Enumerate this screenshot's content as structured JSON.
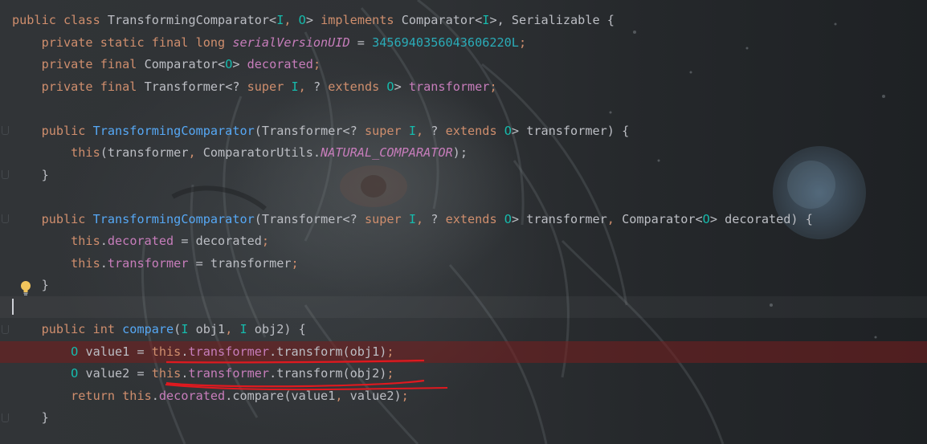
{
  "colors": {
    "keyword": "#cf8e6d",
    "type_param": "#16baac",
    "field": "#c77dbb",
    "number": "#2aacb8",
    "method": "#56a8f5",
    "text": "#bcbec4",
    "breakpoint_line": "#5a2326",
    "annotation_underline": "#e0191f"
  },
  "icons": {
    "intention_bulb": "lightbulb-icon"
  },
  "code": {
    "lines": [
      [
        {
          "t": "public class ",
          "c": "kw"
        },
        {
          "t": "TransformingComparator",
          "c": "cls"
        },
        {
          "t": "<",
          "c": "pun"
        },
        {
          "t": "I",
          "c": "tp"
        },
        {
          "t": ", ",
          "c": "sep"
        },
        {
          "t": "O",
          "c": "tp"
        },
        {
          "t": "> ",
          "c": "pun"
        },
        {
          "t": "implements ",
          "c": "kw"
        },
        {
          "t": "Comparator",
          "c": "cls"
        },
        {
          "t": "<",
          "c": "pun"
        },
        {
          "t": "I",
          "c": "tp"
        },
        {
          "t": ">, ",
          "c": "pun"
        },
        {
          "t": "Serializable ",
          "c": "cls"
        },
        {
          "t": "{",
          "c": "pun"
        }
      ],
      [
        {
          "t": "    private static final long ",
          "c": "kw"
        },
        {
          "t": "serialVersionUID",
          "c": "fld-it"
        },
        {
          "t": " = ",
          "c": "pun"
        },
        {
          "t": "3456940356043606220L",
          "c": "num"
        },
        {
          "t": ";",
          "c": "sep"
        }
      ],
      [
        {
          "t": "    private final ",
          "c": "kw"
        },
        {
          "t": "Comparator",
          "c": "cls"
        },
        {
          "t": "<",
          "c": "pun"
        },
        {
          "t": "O",
          "c": "tp"
        },
        {
          "t": "> ",
          "c": "pun"
        },
        {
          "t": "decorated",
          "c": "fld"
        },
        {
          "t": ";",
          "c": "sep"
        }
      ],
      [
        {
          "t": "    private final ",
          "c": "kw"
        },
        {
          "t": "Transformer",
          "c": "cls"
        },
        {
          "t": "<? ",
          "c": "pun"
        },
        {
          "t": "super ",
          "c": "kw"
        },
        {
          "t": "I",
          "c": "tp"
        },
        {
          "t": ", ",
          "c": "sep"
        },
        {
          "t": "? ",
          "c": "pun"
        },
        {
          "t": "extends ",
          "c": "kw"
        },
        {
          "t": "O",
          "c": "tp"
        },
        {
          "t": "> ",
          "c": "pun"
        },
        {
          "t": "transformer",
          "c": "fld"
        },
        {
          "t": ";",
          "c": "sep"
        }
      ],
      [],
      [
        {
          "t": "    public ",
          "c": "kw"
        },
        {
          "t": "TransformingComparator",
          "c": "mth"
        },
        {
          "t": "(",
          "c": "pun"
        },
        {
          "t": "Transformer",
          "c": "cls"
        },
        {
          "t": "<? ",
          "c": "pun"
        },
        {
          "t": "super ",
          "c": "kw"
        },
        {
          "t": "I",
          "c": "tp"
        },
        {
          "t": ", ",
          "c": "sep"
        },
        {
          "t": "? ",
          "c": "pun"
        },
        {
          "t": "extends ",
          "c": "kw"
        },
        {
          "t": "O",
          "c": "tp"
        },
        {
          "t": "> ",
          "c": "pun"
        },
        {
          "t": "transformer",
          "c": "par"
        },
        {
          "t": ") {",
          "c": "pun"
        }
      ],
      [
        {
          "t": "        this",
          "c": "kw"
        },
        {
          "t": "(transformer",
          "c": "pun"
        },
        {
          "t": ", ",
          "c": "sep"
        },
        {
          "t": "ComparatorUtils.",
          "c": "cls"
        },
        {
          "t": "NATURAL_COMPARATOR",
          "c": "fld-it"
        },
        {
          "t": ");",
          "c": "pun"
        }
      ],
      [
        {
          "t": "    }",
          "c": "pun"
        }
      ],
      [],
      [
        {
          "t": "    public ",
          "c": "kw"
        },
        {
          "t": "TransformingComparator",
          "c": "mth"
        },
        {
          "t": "(",
          "c": "pun"
        },
        {
          "t": "Transformer",
          "c": "cls"
        },
        {
          "t": "<? ",
          "c": "pun"
        },
        {
          "t": "super ",
          "c": "kw"
        },
        {
          "t": "I",
          "c": "tp"
        },
        {
          "t": ", ",
          "c": "sep"
        },
        {
          "t": "? ",
          "c": "pun"
        },
        {
          "t": "extends ",
          "c": "kw"
        },
        {
          "t": "O",
          "c": "tp"
        },
        {
          "t": "> ",
          "c": "pun"
        },
        {
          "t": "transformer",
          "c": "par"
        },
        {
          "t": ", ",
          "c": "sep"
        },
        {
          "t": "Comparator",
          "c": "cls"
        },
        {
          "t": "<",
          "c": "pun"
        },
        {
          "t": "O",
          "c": "tp"
        },
        {
          "t": "> ",
          "c": "pun"
        },
        {
          "t": "decorated",
          "c": "par"
        },
        {
          "t": ") {",
          "c": "pun"
        }
      ],
      [
        {
          "t": "        this",
          "c": "kw"
        },
        {
          "t": ".",
          "c": "pun"
        },
        {
          "t": "decorated",
          "c": "fld"
        },
        {
          "t": " = decorated",
          "c": "pun"
        },
        {
          "t": ";",
          "c": "sep"
        }
      ],
      [
        {
          "t": "        this",
          "c": "kw"
        },
        {
          "t": ".",
          "c": "pun"
        },
        {
          "t": "transformer",
          "c": "fld"
        },
        {
          "t": " = transformer",
          "c": "pun"
        },
        {
          "t": ";",
          "c": "sep"
        }
      ],
      [
        {
          "t": "    }",
          "c": "pun"
        }
      ],
      [],
      [
        {
          "t": "    public int ",
          "c": "kw"
        },
        {
          "t": "compare",
          "c": "mth"
        },
        {
          "t": "(",
          "c": "pun"
        },
        {
          "t": "I",
          "c": "tp"
        },
        {
          "t": " obj1",
          "c": "par"
        },
        {
          "t": ", ",
          "c": "sep"
        },
        {
          "t": "I",
          "c": "tp"
        },
        {
          "t": " obj2) {",
          "c": "pun"
        }
      ],
      [
        {
          "t": "        O",
          "c": "tp"
        },
        {
          "t": " value1 = ",
          "c": "pun"
        },
        {
          "t": "this",
          "c": "kw"
        },
        {
          "t": ".",
          "c": "pun"
        },
        {
          "t": "transformer",
          "c": "fld"
        },
        {
          "t": ".transform(obj1)",
          "c": "pun"
        },
        {
          "t": ";",
          "c": "sep"
        }
      ],
      [
        {
          "t": "        O",
          "c": "tp"
        },
        {
          "t": " value2 = ",
          "c": "pun"
        },
        {
          "t": "this",
          "c": "kw"
        },
        {
          "t": ".",
          "c": "pun"
        },
        {
          "t": "transformer",
          "c": "fld"
        },
        {
          "t": ".transform(obj2)",
          "c": "pun"
        },
        {
          "t": ";",
          "c": "sep"
        }
      ],
      [
        {
          "t": "        return ",
          "c": "kw"
        },
        {
          "t": "this",
          "c": "kw"
        },
        {
          "t": ".",
          "c": "pun"
        },
        {
          "t": "decorated",
          "c": "fld"
        },
        {
          "t": ".compare(value1",
          "c": "pun"
        },
        {
          "t": ", ",
          "c": "sep"
        },
        {
          "t": "value2)",
          "c": "pun"
        },
        {
          "t": ";",
          "c": "sep"
        }
      ],
      [
        {
          "t": "    }",
          "c": "pun"
        }
      ]
    ]
  }
}
